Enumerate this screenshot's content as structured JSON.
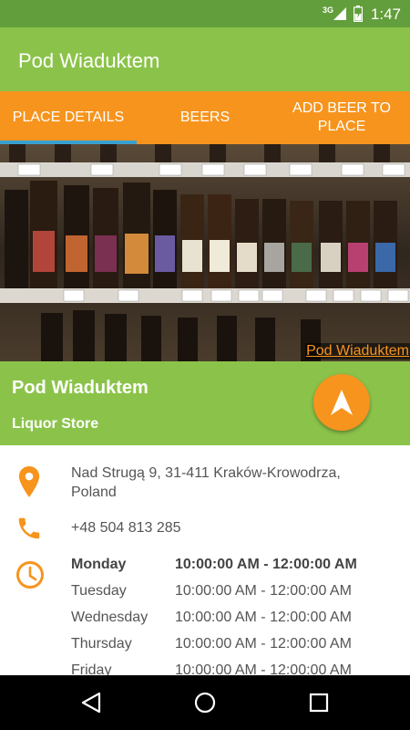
{
  "status_bar": {
    "network": "3G",
    "time": "1:47"
  },
  "app_bar": {
    "title": "Pod Wiaduktem"
  },
  "tabs": [
    {
      "label": "PLACE DETAILS",
      "active": true
    },
    {
      "label": "BEERS",
      "active": false
    },
    {
      "label": "ADD BEER TO PLACE",
      "active": false
    }
  ],
  "hero": {
    "credit": "Pod Wiaduktem"
  },
  "place": {
    "name": "Pod Wiaduktem",
    "type": "Liquor Store"
  },
  "details": {
    "address": "Nad Strugą 9, 31-411 Kraków-Krowodrza, Poland",
    "phone": "+48 504 813 285",
    "hours": [
      {
        "day": "Monday",
        "time": "10:00:00 AM - 12:00:00 AM",
        "today": true
      },
      {
        "day": "Tuesday",
        "time": "10:00:00 AM - 12:00:00 AM",
        "today": false
      },
      {
        "day": "Wednesday",
        "time": "10:00:00 AM - 12:00:00 AM",
        "today": false
      },
      {
        "day": "Thursday",
        "time": "10:00:00 AM - 12:00:00 AM",
        "today": false
      },
      {
        "day": "Friday",
        "time": "10:00:00 AM - 12:00:00 AM",
        "today": false
      }
    ]
  },
  "colors": {
    "primary_green": "#8bc34a",
    "status_green": "#629e3b",
    "accent_orange": "#f7941d",
    "tab_indicator": "#3aa0d0"
  },
  "icons": {
    "fab": "navigation-arrow-icon",
    "address": "location-pin-icon",
    "phone": "phone-icon",
    "hours": "clock-icon",
    "nav": [
      "back-icon",
      "home-icon",
      "recents-icon"
    ]
  }
}
